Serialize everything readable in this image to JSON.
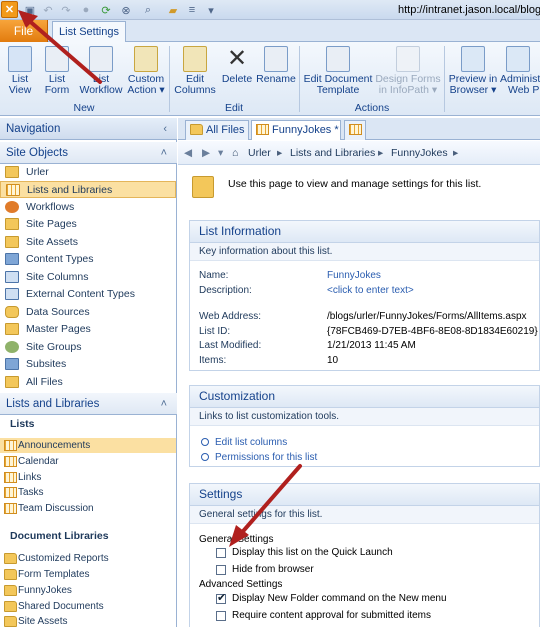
{
  "titlebar": {
    "url": "http://intranet.jason.local/blog"
  },
  "ribbon": {
    "tabs": {
      "file": "File",
      "list_settings": "List Settings"
    },
    "groups": [
      {
        "label": "New",
        "buttons": [
          "List View",
          "List Form",
          "List Workflow",
          "Custom Action"
        ]
      },
      {
        "label": "Edit",
        "buttons": [
          "Edit Columns",
          "Delete",
          "Rename"
        ]
      },
      {
        "label": "Actions",
        "buttons": [
          "Edit Document Template",
          "Design Forms in InfoPath"
        ]
      }
    ],
    "extra_buttons": [
      "Preview in Browser",
      "Administ Web P"
    ],
    "b": {
      "list_view_1": "List",
      "list_view_2": "View",
      "list_form_1": "List",
      "list_form_2": "Form",
      "list_workflow_1": "List",
      "list_workflow_2": "Workflow",
      "custom_action_1": "Custom",
      "custom_action_2": "Action ▾",
      "edit_columns_1": "Edit",
      "edit_columns_2": "Columns",
      "delete": "Delete",
      "rename": "Rename",
      "edit_doc_1": "Edit Document",
      "edit_doc_2": "Template",
      "design_forms_1": "Design Forms",
      "design_forms_2": "in InfoPath ▾",
      "preview_1": "Preview in",
      "preview_2": "Browser ▾",
      "admin_1": "Administ",
      "admin_2": "Web P"
    }
  },
  "navigation": {
    "header": "Navigation",
    "site_objects_header": "Site Objects",
    "site_objects": [
      "Urler",
      "Lists and Libraries",
      "Workflows",
      "Site Pages",
      "Site Assets",
      "Content Types",
      "Site Columns",
      "External Content Types",
      "Data Sources",
      "Master Pages",
      "Site Groups",
      "Subsites",
      "All Files"
    ],
    "lists_libraries_header": "Lists and Libraries",
    "lists_title": "Lists",
    "lists": [
      "Announcements",
      "Calendar",
      "Links",
      "Tasks",
      "Team Discussion"
    ],
    "doclibs_title": "Document Libraries",
    "doclibs": [
      "Customized Reports",
      "Form Templates",
      "FunnyJokes",
      "Shared Documents",
      "Site Assets"
    ]
  },
  "content_tabs": [
    "All Files",
    "FunnyJokes *"
  ],
  "breadcrumb": [
    "Urler",
    "Lists and Libraries",
    "FunnyJokes"
  ],
  "intro": "Use this page to view and manage settings for this list.",
  "list_info": {
    "title": "List Information",
    "desc": "Key information about this list.",
    "name_label": "Name:",
    "name_value": "FunnyJokes",
    "description_label": "Description:",
    "description_value": "<click to enter text>",
    "web_address_label": "Web Address:",
    "web_address_value": "/blogs/urler/FunnyJokes/Forms/AllItems.aspx",
    "list_id_label": "List ID:",
    "list_id_value": "{78FCB469-D7EB-4BF6-8E08-8D1834E60219}",
    "last_modified_label": "Last Modified:",
    "last_modified_value": "1/21/2013 11:45 AM",
    "items_label": "Items:",
    "items_value": "10"
  },
  "customization": {
    "title": "Customization",
    "desc": "Links to list customization tools.",
    "links": [
      "Edit list columns",
      "Permissions for this list"
    ]
  },
  "settings": {
    "title": "Settings",
    "desc": "General settings for this list.",
    "general_title": "General Settings",
    "general": [
      {
        "label": "Display this list on the Quick Launch",
        "checked": false
      },
      {
        "label": "Hide from browser",
        "checked": false
      }
    ],
    "advanced_title": "Advanced Settings",
    "advanced": [
      {
        "label": "Display New Folder command on the New menu",
        "checked": true
      },
      {
        "label": "Require content approval for submitted items",
        "checked": false
      }
    ]
  },
  "colors": {
    "accent": "#15428b",
    "file_tab": "#e8860f",
    "arrow": "#b0201e",
    "selection": "#fbe0a2"
  }
}
